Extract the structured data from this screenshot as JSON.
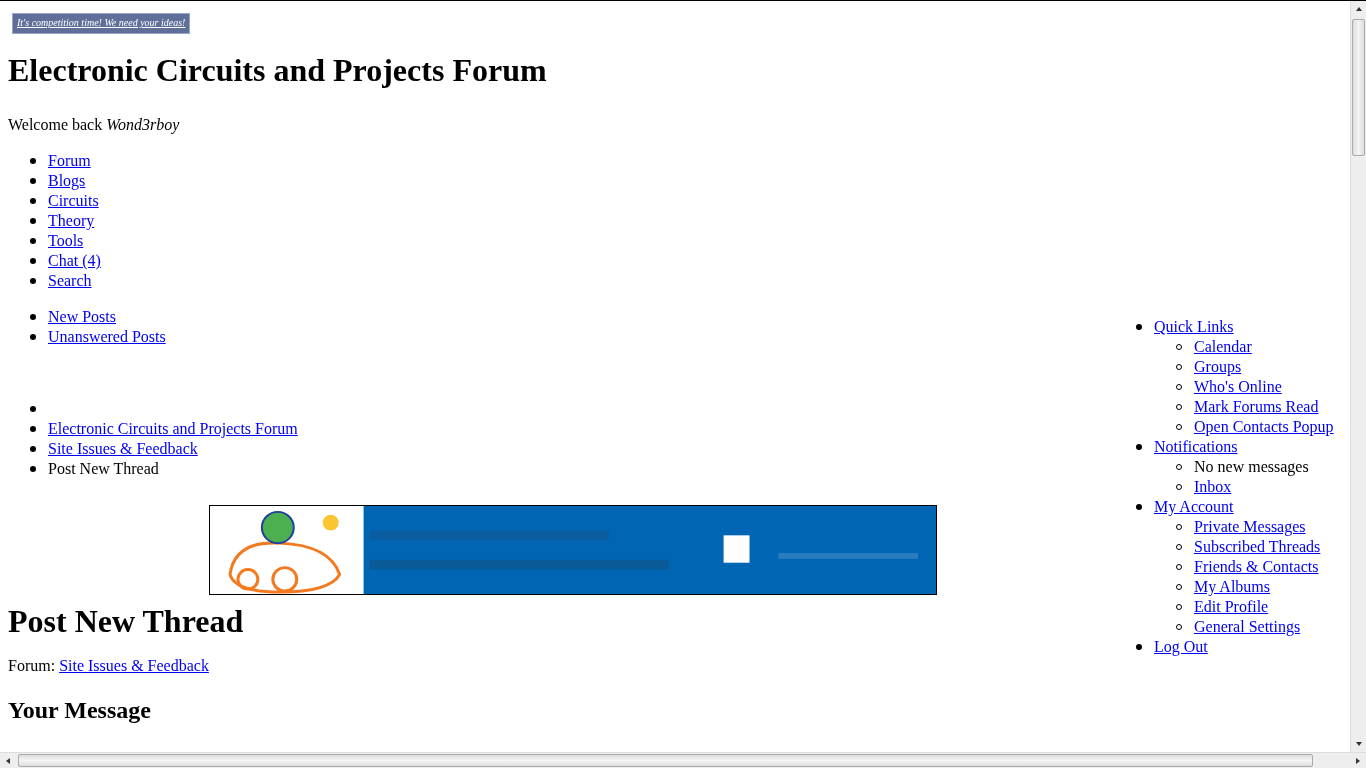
{
  "banner_link": "It's competition time! We need your ideas!",
  "site_title": "Electronic Circuits and Projects Forum",
  "welcome": {
    "label": "Welcome back",
    "username": "Wond3rboy"
  },
  "main_nav": [
    "Forum",
    "Blogs",
    "Circuits",
    "Theory",
    "Tools",
    "Chat (4)",
    "Search"
  ],
  "sub_nav": [
    "New Posts",
    "Unanswered Posts"
  ],
  "breadcrumb": [
    {
      "kind": "blank"
    },
    {
      "kind": "link",
      "label": "Electronic Circuits and Projects Forum"
    },
    {
      "kind": "link",
      "label": "Site Issues & Feedback"
    },
    {
      "kind": "current",
      "label": "Post New Thread"
    }
  ],
  "page_title": "Post New Thread",
  "forum": {
    "label": "Forum:",
    "link": "Site Issues & Feedback"
  },
  "section_title": "Your Message",
  "user_menu": [
    {
      "label": "Quick Links",
      "children": [
        {
          "kind": "link",
          "label": "Calendar"
        },
        {
          "kind": "link",
          "label": "Groups"
        },
        {
          "kind": "link",
          "label": "Who's Online"
        },
        {
          "kind": "link",
          "label": "Mark Forums Read"
        },
        {
          "kind": "link",
          "label": "Open Contacts Popup"
        }
      ]
    },
    {
      "label": "Notifications",
      "children": [
        {
          "kind": "text",
          "label": "No new messages"
        },
        {
          "kind": "link",
          "label": "Inbox"
        }
      ]
    },
    {
      "label": "My Account",
      "children": [
        {
          "kind": "link",
          "label": "Private Messages"
        },
        {
          "kind": "link",
          "label": "Subscribed Threads"
        },
        {
          "kind": "link",
          "label": "Friends & Contacts"
        },
        {
          "kind": "link",
          "label": "My Albums"
        },
        {
          "kind": "link",
          "label": "Edit Profile"
        },
        {
          "kind": "link",
          "label": "General Settings"
        }
      ]
    },
    {
      "label": "Log Out"
    }
  ]
}
